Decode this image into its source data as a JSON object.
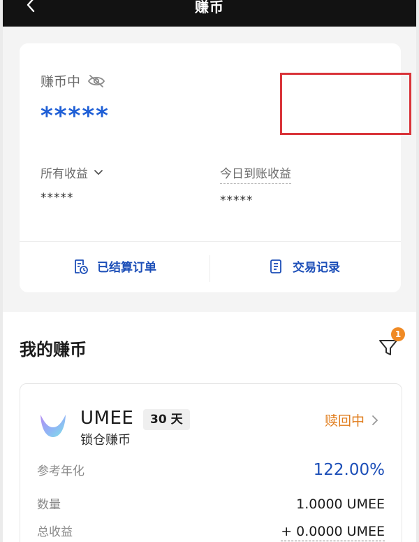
{
  "header": {
    "title": "赚币"
  },
  "balance_card": {
    "earning_label": "赚币中",
    "balance_value": "*****",
    "all_income_label": "所有收益",
    "all_income_value": "*****",
    "today_income_label": "今日到账收益",
    "today_income_value": "*****",
    "settled_orders_label": "已结算订单",
    "transaction_records_label": "交易记录"
  },
  "section": {
    "title": "我的赚币",
    "filter_badge_count": "1"
  },
  "product": {
    "coin_name": "UMEE",
    "term_badge": "30 天",
    "type_label": "锁仓赚币",
    "status_label": "赎回中",
    "rows": {
      "apy_label": "参考年化",
      "apy_value": "122.00%",
      "quantity_label": "数量",
      "quantity_value": "1.0000 UMEE",
      "total_income_label": "总收益",
      "total_income_value": "+ 0.0000 UMEE"
    }
  },
  "colors": {
    "accent_blue": "#1d4fb8",
    "status_orange": "#e07b1a",
    "badge_orange": "#f08a24",
    "highlight_red": "#d9343a"
  }
}
